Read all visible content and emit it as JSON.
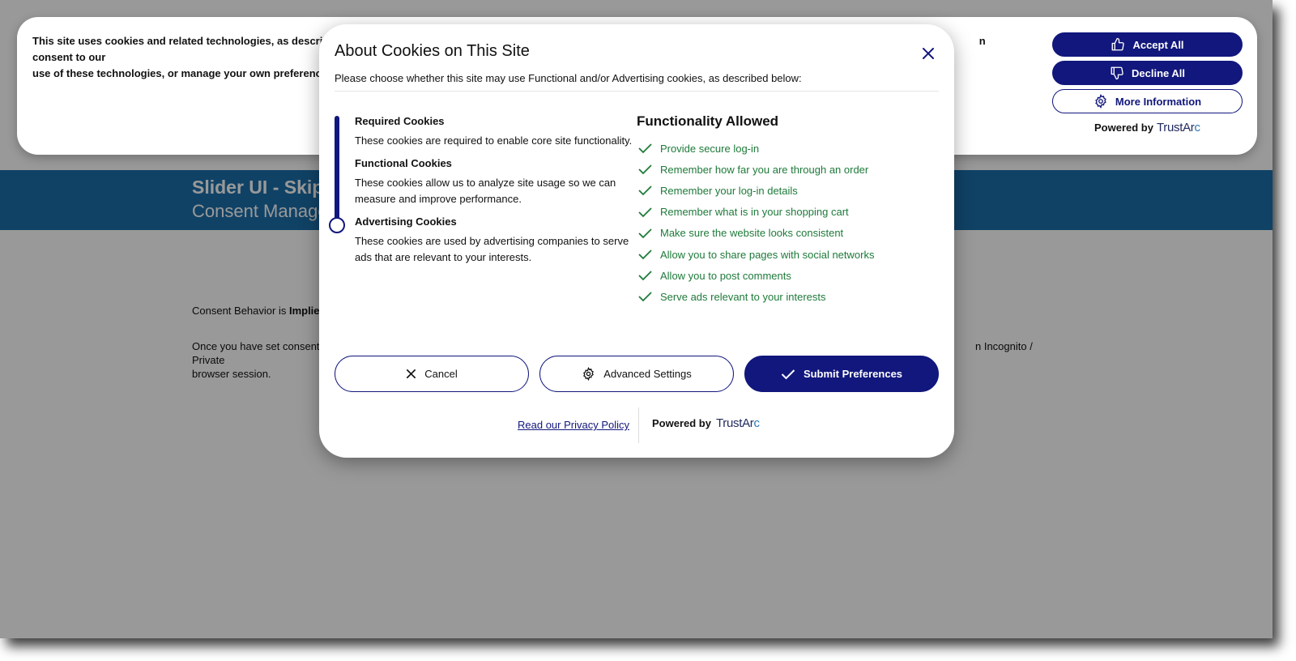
{
  "page": {
    "title": "Slider UI - Skip c",
    "subtitle": "Consent Manage",
    "consent_behavior_prefix": "Consent Behavior is ",
    "consent_behavior_value": "Implied",
    "note_start": "Once you have set consent th",
    "note_end": "n Incognito / Private",
    "note_line2": "browser session."
  },
  "banner": {
    "text_start": "This site uses cookies and related technologies, as described i",
    "text_end": "n consent to our",
    "text_line2": "use of these technologies, or manage your own preferences.",
    "accept_label": "Accept All",
    "decline_label": "Decline All",
    "more_label": "More Information",
    "powered_by": "Powered by",
    "brand_trust": "TrustAr",
    "brand_arc": "c"
  },
  "modal": {
    "title": "About Cookies on This Site",
    "subtitle": "Please choose whether this site may use Functional and/or Advertising cookies, as described below:",
    "categories": [
      {
        "title": "Required Cookies",
        "desc": "These cookies are required to enable core site functionality."
      },
      {
        "title": "Functional Cookies",
        "desc": "These cookies allow us to analyze site usage so we can measure and improve performance."
      },
      {
        "title": "Advertising Cookies",
        "desc": "These cookies are used by advertising companies to serve ads that are relevant to your interests."
      }
    ],
    "slider_level": 3,
    "functionality_title": "Functionality Allowed",
    "functionality": [
      "Provide secure log-in",
      "Remember how far you are through an order",
      "Remember your log-in details",
      "Remember what is in your shopping cart",
      "Make sure the website looks consistent",
      "Allow you to share pages with social networks",
      "Allow you to post comments",
      "Serve ads relevant to your interests"
    ],
    "cancel_label": "Cancel",
    "advanced_label": "Advanced Settings",
    "submit_label": "Submit Preferences",
    "privacy_link": "Read our Privacy Policy",
    "powered_by": "Powered by",
    "brand_trust": "TrustAr",
    "brand_arc": "c"
  },
  "colors": {
    "brand_navy": "#11177c",
    "header_blue": "#1c6eaa",
    "allowed_green": "#1e7a3a"
  }
}
